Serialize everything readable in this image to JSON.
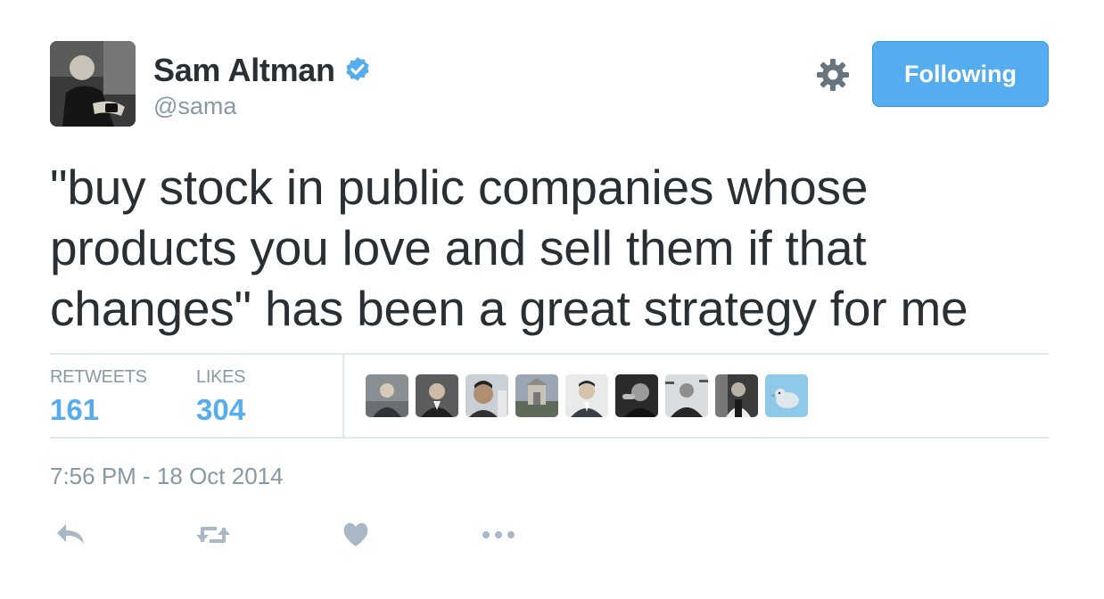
{
  "user": {
    "display_name": "Sam Altman",
    "screen_name": "@sama",
    "verified": true
  },
  "follow_button": {
    "label": "Following"
  },
  "tweet": {
    "text": "\"buy stock in public companies whose products you love and sell them if that changes\" has been a great strategy for me",
    "timestamp": "7:56 PM - 18 Oct 2014"
  },
  "stats": {
    "retweets_label": "RETWEETS",
    "retweets_count": "161",
    "likes_label": "LIKES",
    "likes_count": "304"
  },
  "icons": {
    "verified": "verified-badge-icon",
    "settings": "gear-icon",
    "reply": "reply-icon",
    "retweet": "retweet-icon",
    "like": "heart-icon",
    "more": "more-icon"
  },
  "colors": {
    "accent": "#55acee",
    "muted": "#8899a6",
    "text": "#292f33",
    "divider": "#e1e8ed",
    "action_icon": "#a9b8c6"
  }
}
